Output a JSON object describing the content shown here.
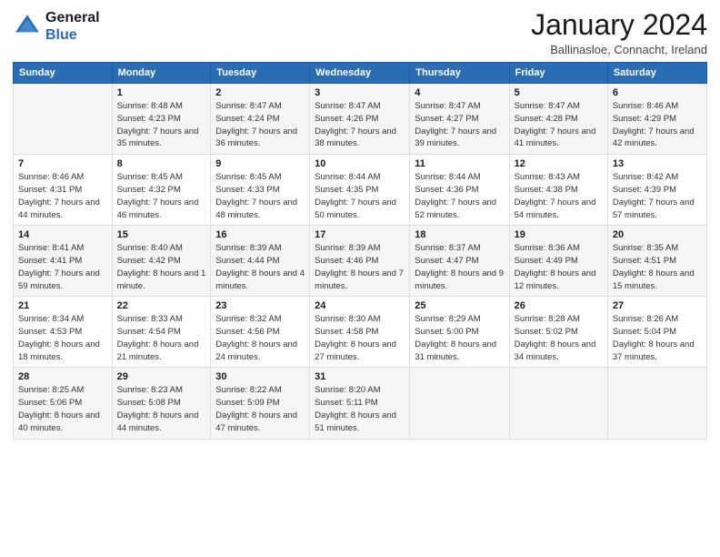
{
  "logo": {
    "line1": "General",
    "line2": "Blue"
  },
  "title": "January 2024",
  "location": "Ballinasloe, Connacht, Ireland",
  "weekdays": [
    "Sunday",
    "Monday",
    "Tuesday",
    "Wednesday",
    "Thursday",
    "Friday",
    "Saturday"
  ],
  "weeks": [
    [
      {
        "day": "",
        "sunrise": "",
        "sunset": "",
        "daylight": ""
      },
      {
        "day": "1",
        "sunrise": "Sunrise: 8:48 AM",
        "sunset": "Sunset: 4:23 PM",
        "daylight": "Daylight: 7 hours and 35 minutes."
      },
      {
        "day": "2",
        "sunrise": "Sunrise: 8:47 AM",
        "sunset": "Sunset: 4:24 PM",
        "daylight": "Daylight: 7 hours and 36 minutes."
      },
      {
        "day": "3",
        "sunrise": "Sunrise: 8:47 AM",
        "sunset": "Sunset: 4:26 PM",
        "daylight": "Daylight: 7 hours and 38 minutes."
      },
      {
        "day": "4",
        "sunrise": "Sunrise: 8:47 AM",
        "sunset": "Sunset: 4:27 PM",
        "daylight": "Daylight: 7 hours and 39 minutes."
      },
      {
        "day": "5",
        "sunrise": "Sunrise: 8:47 AM",
        "sunset": "Sunset: 4:28 PM",
        "daylight": "Daylight: 7 hours and 41 minutes."
      },
      {
        "day": "6",
        "sunrise": "Sunrise: 8:46 AM",
        "sunset": "Sunset: 4:29 PM",
        "daylight": "Daylight: 7 hours and 42 minutes."
      }
    ],
    [
      {
        "day": "7",
        "sunrise": "Sunrise: 8:46 AM",
        "sunset": "Sunset: 4:31 PM",
        "daylight": "Daylight: 7 hours and 44 minutes."
      },
      {
        "day": "8",
        "sunrise": "Sunrise: 8:45 AM",
        "sunset": "Sunset: 4:32 PM",
        "daylight": "Daylight: 7 hours and 46 minutes."
      },
      {
        "day": "9",
        "sunrise": "Sunrise: 8:45 AM",
        "sunset": "Sunset: 4:33 PM",
        "daylight": "Daylight: 7 hours and 48 minutes."
      },
      {
        "day": "10",
        "sunrise": "Sunrise: 8:44 AM",
        "sunset": "Sunset: 4:35 PM",
        "daylight": "Daylight: 7 hours and 50 minutes."
      },
      {
        "day": "11",
        "sunrise": "Sunrise: 8:44 AM",
        "sunset": "Sunset: 4:36 PM",
        "daylight": "Daylight: 7 hours and 52 minutes."
      },
      {
        "day": "12",
        "sunrise": "Sunrise: 8:43 AM",
        "sunset": "Sunset: 4:38 PM",
        "daylight": "Daylight: 7 hours and 54 minutes."
      },
      {
        "day": "13",
        "sunrise": "Sunrise: 8:42 AM",
        "sunset": "Sunset: 4:39 PM",
        "daylight": "Daylight: 7 hours and 57 minutes."
      }
    ],
    [
      {
        "day": "14",
        "sunrise": "Sunrise: 8:41 AM",
        "sunset": "Sunset: 4:41 PM",
        "daylight": "Daylight: 7 hours and 59 minutes."
      },
      {
        "day": "15",
        "sunrise": "Sunrise: 8:40 AM",
        "sunset": "Sunset: 4:42 PM",
        "daylight": "Daylight: 8 hours and 1 minute."
      },
      {
        "day": "16",
        "sunrise": "Sunrise: 8:39 AM",
        "sunset": "Sunset: 4:44 PM",
        "daylight": "Daylight: 8 hours and 4 minutes."
      },
      {
        "day": "17",
        "sunrise": "Sunrise: 8:39 AM",
        "sunset": "Sunset: 4:46 PM",
        "daylight": "Daylight: 8 hours and 7 minutes."
      },
      {
        "day": "18",
        "sunrise": "Sunrise: 8:37 AM",
        "sunset": "Sunset: 4:47 PM",
        "daylight": "Daylight: 8 hours and 9 minutes."
      },
      {
        "day": "19",
        "sunrise": "Sunrise: 8:36 AM",
        "sunset": "Sunset: 4:49 PM",
        "daylight": "Daylight: 8 hours and 12 minutes."
      },
      {
        "day": "20",
        "sunrise": "Sunrise: 8:35 AM",
        "sunset": "Sunset: 4:51 PM",
        "daylight": "Daylight: 8 hours and 15 minutes."
      }
    ],
    [
      {
        "day": "21",
        "sunrise": "Sunrise: 8:34 AM",
        "sunset": "Sunset: 4:53 PM",
        "daylight": "Daylight: 8 hours and 18 minutes."
      },
      {
        "day": "22",
        "sunrise": "Sunrise: 8:33 AM",
        "sunset": "Sunset: 4:54 PM",
        "daylight": "Daylight: 8 hours and 21 minutes."
      },
      {
        "day": "23",
        "sunrise": "Sunrise: 8:32 AM",
        "sunset": "Sunset: 4:56 PM",
        "daylight": "Daylight: 8 hours and 24 minutes."
      },
      {
        "day": "24",
        "sunrise": "Sunrise: 8:30 AM",
        "sunset": "Sunset: 4:58 PM",
        "daylight": "Daylight: 8 hours and 27 minutes."
      },
      {
        "day": "25",
        "sunrise": "Sunrise: 8:29 AM",
        "sunset": "Sunset: 5:00 PM",
        "daylight": "Daylight: 8 hours and 31 minutes."
      },
      {
        "day": "26",
        "sunrise": "Sunrise: 8:28 AM",
        "sunset": "Sunset: 5:02 PM",
        "daylight": "Daylight: 8 hours and 34 minutes."
      },
      {
        "day": "27",
        "sunrise": "Sunrise: 8:26 AM",
        "sunset": "Sunset: 5:04 PM",
        "daylight": "Daylight: 8 hours and 37 minutes."
      }
    ],
    [
      {
        "day": "28",
        "sunrise": "Sunrise: 8:25 AM",
        "sunset": "Sunset: 5:06 PM",
        "daylight": "Daylight: 8 hours and 40 minutes."
      },
      {
        "day": "29",
        "sunrise": "Sunrise: 8:23 AM",
        "sunset": "Sunset: 5:08 PM",
        "daylight": "Daylight: 8 hours and 44 minutes."
      },
      {
        "day": "30",
        "sunrise": "Sunrise: 8:22 AM",
        "sunset": "Sunset: 5:09 PM",
        "daylight": "Daylight: 8 hours and 47 minutes."
      },
      {
        "day": "31",
        "sunrise": "Sunrise: 8:20 AM",
        "sunset": "Sunset: 5:11 PM",
        "daylight": "Daylight: 8 hours and 51 minutes."
      },
      {
        "day": "",
        "sunrise": "",
        "sunset": "",
        "daylight": ""
      },
      {
        "day": "",
        "sunrise": "",
        "sunset": "",
        "daylight": ""
      },
      {
        "day": "",
        "sunrise": "",
        "sunset": "",
        "daylight": ""
      }
    ]
  ]
}
